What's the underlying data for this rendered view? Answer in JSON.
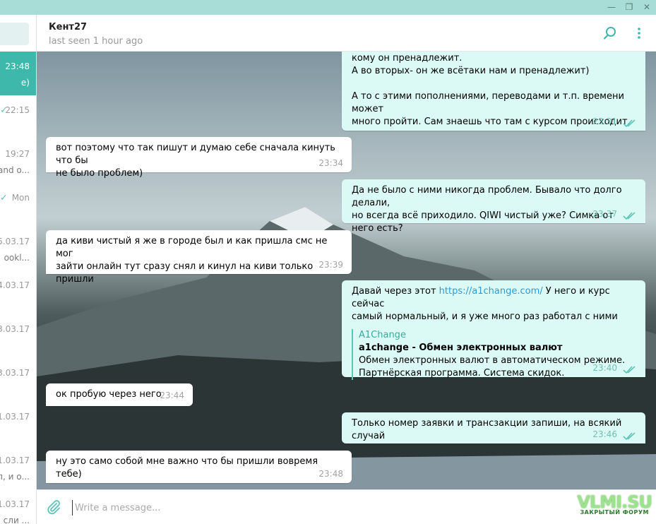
{
  "window": {
    "minimize": "—",
    "maximize": "❐",
    "close": "✕"
  },
  "sidebar": {
    "items": [
      {
        "time": "23:48",
        "snippet": "e)",
        "active": true
      },
      {
        "time": "22:15",
        "snippet": "",
        "read": true
      },
      {
        "time": "19:27",
        "snippet": "and o..."
      },
      {
        "time": "Mon",
        "snippet": "",
        "read": true
      },
      {
        "time": "5.03.17",
        "snippet": "ookl..."
      },
      {
        "time": "4.03.17",
        "snippet": ""
      },
      {
        "time": "3.03.17",
        "snippet": ""
      },
      {
        "time": "3.03.17",
        "snippet": ""
      },
      {
        "time": "1.03.17",
        "snippet": ""
      },
      {
        "time": "1.03.17",
        "snippet": "л, и о..."
      },
      {
        "time": "1.03.17",
        "snippet": "сли ..."
      }
    ]
  },
  "header": {
    "name": "Кент27",
    "status": "last seen 1 hour ago"
  },
  "messages": [
    {
      "id": "m1",
      "dir": "out",
      "lines": [
        "кому он пренадлежит.",
        "А во вторых- он же всётаки нам и пренадлежит)",
        "",
        "А то с этими пополнениями, переводами и т.п. времени может",
        "много пройти. Сам знаешь что там с курсом происходит."
      ],
      "time": "23:31"
    },
    {
      "id": "m2",
      "dir": "in",
      "lines": [
        "вот поэтому что так пишут и думаю себе сначала кинуть что бы",
        "не было проблем)"
      ],
      "time": "23:34"
    },
    {
      "id": "m3",
      "dir": "out",
      "lines": [
        "Да не было с ними никогда проблем. Бывало что долго делали,",
        "но всегда всё приходило. QIWI чистый уже? Симка от него есть?"
      ],
      "time": "23:37"
    },
    {
      "id": "m4",
      "dir": "in",
      "lines": [
        "да киви чистый я же в городе был и как пришла смс не мог",
        "зайти онлайн тут сразу снял и кинул на киви только пришли"
      ],
      "time": "23:39"
    },
    {
      "id": "m5",
      "dir": "out",
      "before_link": "Давай через этот ",
      "link": "https://a1change.com/",
      "after_link": " У него и курс сейчас",
      "line2": "самый нормальный, и я уже много раз работал с ними",
      "preview": {
        "site": "A1Change",
        "title": "a1change - Обмен электронных валют",
        "desc1": "Обмен электронных валют в автоматическом режиме.",
        "desc2": "Партнёрская программа. Система скидок."
      },
      "time": "23:40"
    },
    {
      "id": "m6",
      "dir": "in",
      "lines": [
        "ок пробую через него"
      ],
      "time": "23:44"
    },
    {
      "id": "m7",
      "dir": "out",
      "lines": [
        "Только номер заявки и трансзакции запиши, на всякий случай"
      ],
      "time": "23:46"
    },
    {
      "id": "m8",
      "dir": "in",
      "lines": [
        "ну это само собой мне важно что бы пришли вовремя тебе)"
      ],
      "time": "23:48"
    }
  ],
  "composer": {
    "placeholder": "Write a message..."
  },
  "watermark": {
    "logo": "VLMI.SU",
    "sub": "ЗАКРЫТЫЙ ФОРУМ"
  }
}
